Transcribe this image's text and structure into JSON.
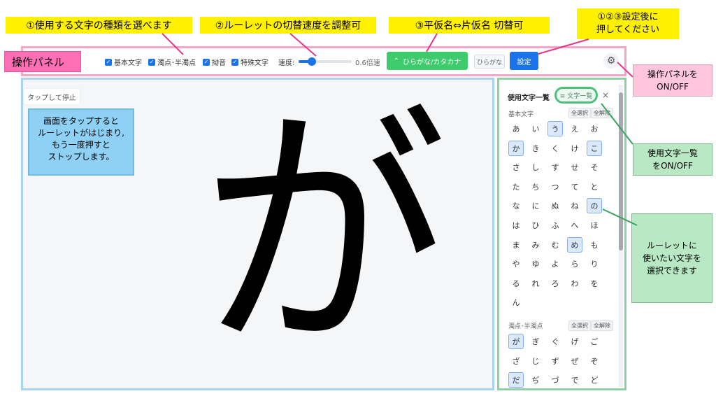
{
  "annotations": {
    "charset_choice": "①使用する文字の種類を選べます",
    "speed_adjust": "②ルーレットの切替速度を調整可",
    "kana_switch": "③平仮名⇔片仮名 切替可",
    "after_settings_line1": "①②③設定後に",
    "after_settings_line2": "押してください",
    "panel_toggle_line1": "操作パネルを",
    "panel_toggle_line2": "ON/OFF",
    "list_toggle_line1": "使用文字一覧",
    "list_toggle_line2": "をON/OFF",
    "select_chars_line1": "ルーレットに",
    "select_chars_line2": "使いたい文字を",
    "select_chars_line3": "選択できます",
    "tap_info_line1": "画面をタップすると",
    "tap_info_line2": "ルーレットがはじまり,",
    "tap_info_line3": "もう一度押すと",
    "tap_info_line4": "ストップします。"
  },
  "panel": {
    "label": "操作パネル",
    "checkboxes": [
      "基本文字",
      "濁点･半濁点",
      "拗音",
      "特殊文字"
    ],
    "checked": [
      true,
      true,
      true,
      true
    ],
    "speed_label": "速度:",
    "speed_value": "0.6倍速",
    "speed_fraction": 0.25,
    "kana_toggle_label": "ひらがな/カタカナ",
    "mode_chip": "ひらがな",
    "set_button": "設定",
    "gear_icon": "gear-icon"
  },
  "stage": {
    "stop_chip": "タップして停止",
    "current_char": "が"
  },
  "side": {
    "title": "使用文字一覧",
    "list_toggle": "≡ 文字一覧",
    "close": "×",
    "select_all": "全選択",
    "deselect_all": "全解除",
    "basic_label": "基本文字",
    "dakuten_label": "濁点･半濁点",
    "basic_rows": [
      [
        "あ",
        "い",
        "う",
        "え",
        "お"
      ],
      [
        "か",
        "き",
        "く",
        "け",
        "こ"
      ],
      [
        "さ",
        "し",
        "す",
        "せ",
        "そ"
      ],
      [
        "た",
        "ち",
        "つ",
        "て",
        "と"
      ],
      [
        "な",
        "に",
        "ぬ",
        "ね",
        "の"
      ],
      [
        "は",
        "ひ",
        "ふ",
        "へ",
        "ほ"
      ],
      [
        "ま",
        "み",
        "む",
        "め",
        "も"
      ],
      [
        "や",
        "ゆ",
        "よ",
        "ら",
        "り"
      ],
      [
        "る",
        "れ",
        "ろ",
        "わ",
        "を"
      ],
      [
        "ん"
      ]
    ],
    "basic_selected": [
      "う",
      "か",
      "こ",
      "の",
      "め"
    ],
    "dakuten_rows": [
      [
        "が",
        "ぎ",
        "ぐ",
        "げ",
        "ご"
      ],
      [
        "ざ",
        "じ",
        "ず",
        "ぜ",
        "ぞ"
      ],
      [
        "だ",
        "ぢ",
        "づ",
        "で",
        "ど"
      ]
    ],
    "dakuten_selected": [
      "が",
      "だ"
    ]
  },
  "colors": {
    "accent_blue": "#1a73e8",
    "toggle_green": "#3dcb6e",
    "callout_yellow": "#fff100",
    "panel_pink": "#ff6fb5",
    "callout_pink": "#ffc6de",
    "callout_green": "#b8e8c4",
    "info_blue": "#8fd1f5"
  }
}
